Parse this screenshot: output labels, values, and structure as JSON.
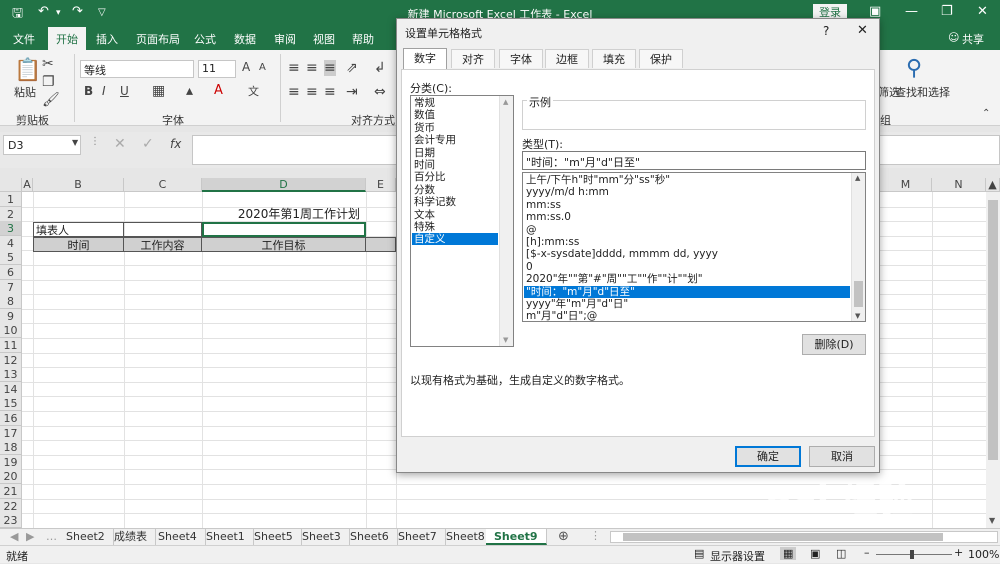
{
  "titlebar": {
    "title": "新建 Microsoft Excel 工作表 - Excel",
    "login_label": "登录",
    "save_icon": "save-icon",
    "undo_icon": "undo-icon",
    "redo_icon": "redo-icon"
  },
  "ribbon_tabs": {
    "file": "文件",
    "home": "开始",
    "insert": "插入",
    "layout": "页面布局",
    "formulas": "公式",
    "data": "数据",
    "review": "审阅",
    "view": "视图",
    "help": "帮助",
    "share": "共享"
  },
  "ribbon": {
    "paste_label": "粘贴",
    "clipboard_group": "剪贴板",
    "font_name": "等线",
    "font_size": "11",
    "font_group": "字体",
    "align_group": "对齐方式",
    "find_select": "查找和选择",
    "filter_label": "筛选",
    "group_tail": "组"
  },
  "formula_bar": {
    "name_box": "D3",
    "fx": "fx",
    "value": ""
  },
  "sheet": {
    "columns": [
      "A",
      "B",
      "C",
      "D",
      "E",
      "M",
      "N"
    ],
    "rows": [
      "1",
      "2",
      "3",
      "4",
      "5",
      "6",
      "7",
      "8",
      "9",
      "10",
      "11",
      "12",
      "13",
      "14",
      "15",
      "16",
      "17",
      "18",
      "19",
      "20",
      "21",
      "22",
      "23"
    ],
    "title_cell": "2020年第1周工作计划",
    "a3": "填表人",
    "h_time": "时间",
    "h_content": "工作内容",
    "h_goal": "工作目标"
  },
  "sheet_tabs": [
    "Sheet2",
    "成绩表",
    "Sheet4",
    "Sheet1",
    "Sheet5",
    "Sheet3",
    "Sheet6",
    "Sheet7",
    "Sheet8",
    "Sheet9"
  ],
  "active_sheet": "Sheet9",
  "statusbar": {
    "mode": "就绪",
    "display_settings": "显示器设置",
    "zoom": "100%"
  },
  "dialog": {
    "title": "设置单元格格式",
    "help": "?",
    "close": "✕",
    "tabs": [
      "数字",
      "对齐",
      "字体",
      "边框",
      "填充",
      "保护"
    ],
    "category_label": "分类(C):",
    "categories": [
      "常规",
      "数值",
      "货币",
      "会计专用",
      "日期",
      "时间",
      "百分比",
      "分数",
      "科学记数",
      "文本",
      "特殊",
      "自定义"
    ],
    "selected_category": "自定义",
    "sample_label": "示例",
    "type_label": "类型(T):",
    "type_value": "\"时间：\"m\"月\"d\"日至\"",
    "formats": [
      "上午/下午h\"时\"mm\"分\"ss\"秒\"",
      "yyyy/m/d h:mm",
      "mm:ss",
      "mm:ss.0",
      "@",
      "[h]:mm:ss",
      "[$-x-sysdate]dddd, mmmm dd, yyyy",
      "0",
      "2020\"年\"\"第\"#\"周\"\"工\"\"作\"\"计\"\"划\"",
      "\"时间：\"m\"月\"d\"日至\"",
      "yyyy\"年\"m\"月\"d\"日\"",
      "m\"月\"d\"日\";@"
    ],
    "selected_format": "\"时间：\"m\"月\"d\"日至\"",
    "delete_button": "删除(D)",
    "description": "以现有格式为基础，生成自定义的数字格式。",
    "ok_button": "确定",
    "cancel_button": "取消"
  },
  "watermark": {
    "brand": "Bai 经验",
    "url": "jingyan.baidu.com"
  },
  "colors": {
    "excel_green": "#217346",
    "selection_blue": "#0078d7"
  }
}
